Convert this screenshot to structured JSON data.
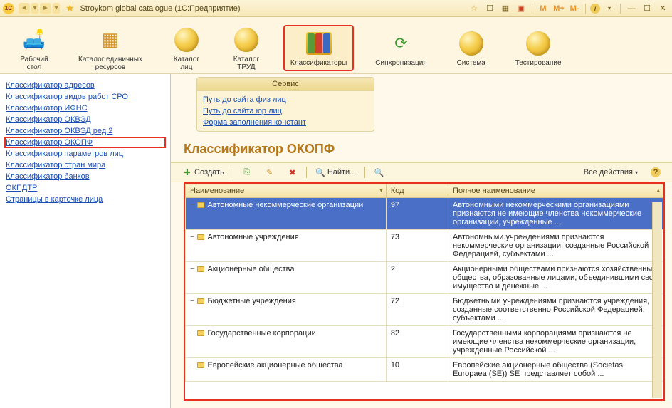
{
  "titlebar": {
    "app_icon_text": "1C",
    "title": "Stroykom global catalogue  (1С:Предприятие)",
    "m_buttons": [
      "M",
      "M+",
      "M-"
    ]
  },
  "topnav": [
    {
      "label": "Рабочий\nстол",
      "icon": "desk"
    },
    {
      "label": "Каталог единичных\nресурсов",
      "icon": "boxes"
    },
    {
      "label": "Каталог\nлиц",
      "icon": "ball"
    },
    {
      "label": "Каталог\nТРУД",
      "icon": "ball"
    },
    {
      "label": "Классификаторы",
      "icon": "folders",
      "selected": true
    },
    {
      "label": "Синхронизация",
      "icon": "sync"
    },
    {
      "label": "Система",
      "icon": "ball"
    },
    {
      "label": "Тестирование",
      "icon": "ball"
    }
  ],
  "sidebar": {
    "items": [
      "Классификатор адресов",
      "Классификатор видов работ СРО",
      "Классификатор ИФНС",
      "Классификатор ОКВЭД",
      "Классификатор ОКВЭД ред.2",
      "Классификатор ОКОПФ",
      "Классификатор параметров лиц",
      "Классификатор стран мира",
      "Классификатор банков",
      "ОКПДТР",
      "Страницы в карточке лица"
    ],
    "highlighted_index": 5
  },
  "service": {
    "header": "Сервис",
    "links": [
      "Путь до сайта физ лиц",
      "Путь до сайта юр лиц",
      "Форма заполнения констант"
    ]
  },
  "page": {
    "title": "Классификатор ОКОПФ"
  },
  "toolbar": {
    "create": "Создать",
    "find": "Найти...",
    "all_actions": "Все действия"
  },
  "grid": {
    "columns": [
      "Наименование",
      "Код",
      "Полное наименование"
    ],
    "rows": [
      {
        "name": "Автономные некоммерческие организации",
        "code": "97",
        "full": "Автономными некоммерческими организациями признаются не имеющие членства некоммерческие организации, учрежденные ...",
        "selected": true
      },
      {
        "name": "Автономные учреждения",
        "code": "73",
        "full": "Автономными учреждениями признаются некоммерческие организации, созданные Российской Федерацией, субъектами ..."
      },
      {
        "name": "Акционерные общества",
        "code": "2",
        "full": "Акционерными обществами признаются хозяйственные общества, образованные лицами, объединившими свое имущество и денежные ..."
      },
      {
        "name": "Бюджетные учреждения",
        "code": "72",
        "full": "Бюджетными учреждениями признаются учреждения, созданные соответственно Российской Федерацией, субъектами ..."
      },
      {
        "name": "Государственные корпорации",
        "code": "82",
        "full": "Государственными корпорациями признаются не имеющие членства некоммерческие организации, учрежденные Российской ..."
      },
      {
        "name": "Европейские акционерные общества",
        "code": "10",
        "full": "Европейские акционерные общества (Societas Europaea (SE))\nSE представляет собой ..."
      }
    ]
  }
}
